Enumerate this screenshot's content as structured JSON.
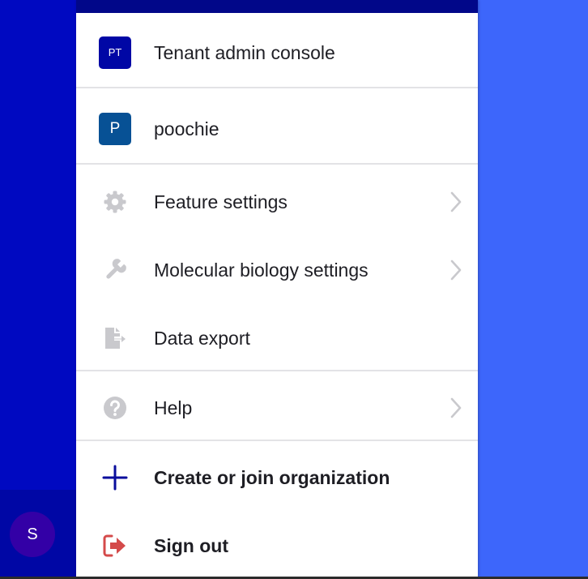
{
  "colors": {
    "background_right": "#3d66fb",
    "left_rail": "#0009c1",
    "rail_bottom": "#0007a5",
    "menu_topbar": "#010789",
    "badge_tenant": "#0007a5",
    "badge_org": "#075195",
    "avatar": "#3300a6",
    "icon_muted": "#c9c9cd",
    "icon_plus": "#0a0d9c",
    "icon_signout": "#d44a4a"
  },
  "user": {
    "avatar_initial": "S"
  },
  "menu": {
    "tenant": {
      "badge": "PT",
      "label": "Tenant admin console"
    },
    "org": {
      "badge": "P",
      "label": "poochie"
    },
    "feature_settings": {
      "icon": "gear-icon",
      "label": "Feature settings"
    },
    "molbio_settings": {
      "icon": "wrench-icon",
      "label": "Molecular biology settings"
    },
    "data_export": {
      "icon": "file-export-icon",
      "label": "Data export"
    },
    "help": {
      "icon": "question-circle-icon",
      "label": "Help"
    },
    "create_org": {
      "icon": "plus-icon",
      "label": "Create or join organization"
    },
    "sign_out": {
      "icon": "sign-out-icon",
      "label": "Sign out"
    }
  }
}
